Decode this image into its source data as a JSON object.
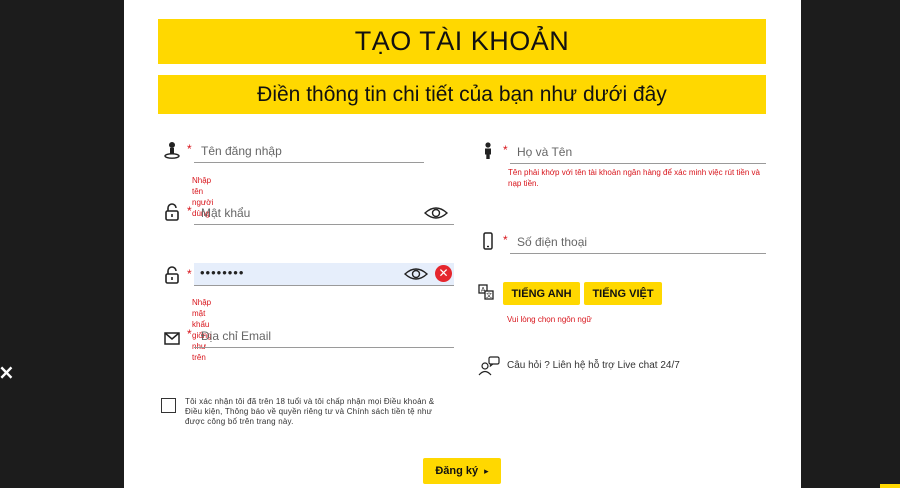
{
  "page": {
    "close_symbol": "×",
    "title": "TẠO TÀI KHOẢN",
    "subtitle": "Điền thông tin chi tiết của bạn như dưới đây"
  },
  "form": {
    "required_mark": "*",
    "username": {
      "placeholder": "Tên đăng nhập",
      "error": "Nhập tên người dùng",
      "icon": "user-location-icon"
    },
    "password": {
      "placeholder": "Mật khẩu",
      "icon": "padlock-icon",
      "toggle_icon": "eye-icon"
    },
    "confirm_password": {
      "value": "••••••••",
      "error": "Nhập mật khẩu giống như trên",
      "icon": "padlock-icon",
      "toggle_icon": "eye-icon",
      "clear_icon": "clear-x-icon",
      "clear_symbol": "✕"
    },
    "email": {
      "placeholder": "Địa chỉ Email",
      "icon": "envelope-icon"
    },
    "fullname": {
      "placeholder": "Họ và Tên",
      "error": "Tên phải khớp với tên tài khoản ngân hàng để xác minh việc rút tiền và nạp tiền.",
      "icon": "person-icon"
    },
    "phone": {
      "placeholder": "Số điện thoại",
      "icon": "phone-icon"
    },
    "language": {
      "icon": "translate-icon",
      "options": [
        "TIẾNG ANH",
        "TIẾNG VIỆT"
      ],
      "error": "Vui lòng chọn ngôn ngữ"
    },
    "help": {
      "icon": "support-chat-icon",
      "text": "Câu hỏi ? Liên hệ hỗ trợ Live chat 24/7"
    },
    "terms": {
      "text": "Tôi xác nhận tôi đã trên 18 tuổi và tôi chấp nhận mọi Điều khoản & Điều kiện, Thông báo về quyền riêng tư và Chính sách tiền tệ như được công bố trên trang này.",
      "checked": false
    },
    "submit": {
      "label": "Đăng ký",
      "arrow": "▸"
    }
  },
  "colors": {
    "accent": "#ffd800",
    "error": "#d8141b",
    "backdrop": "#1c1c1c"
  }
}
